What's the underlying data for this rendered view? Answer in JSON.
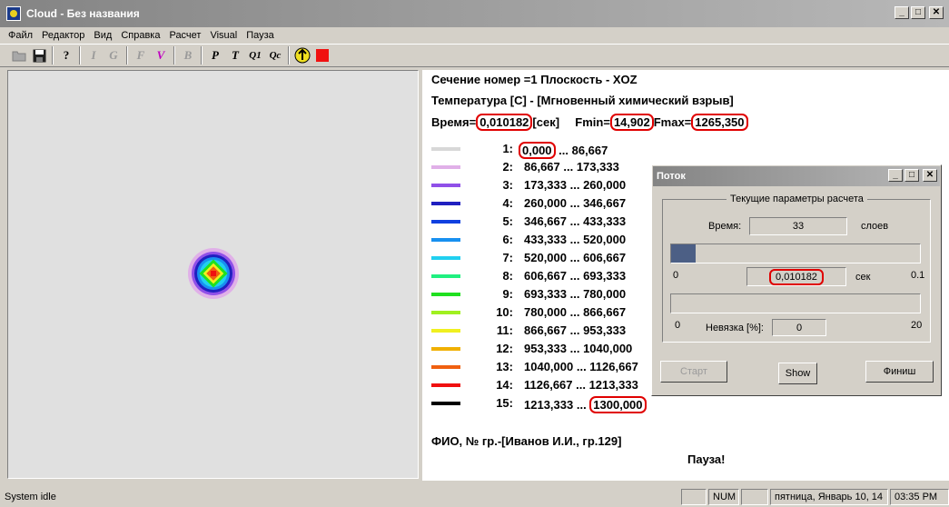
{
  "window": {
    "title": "Cloud - Без названия"
  },
  "menu": [
    "Файл",
    "Редактор",
    "Вид",
    "Справка",
    "Расчет",
    "Visual",
    "Пауза"
  ],
  "toolbar": [
    {
      "name": "open-folder-icon",
      "label": ""
    },
    {
      "name": "save-icon",
      "label": ""
    },
    {
      "name": "help-icon",
      "label": "?"
    },
    {
      "name": "tool-i-icon",
      "label": "I"
    },
    {
      "name": "tool-g-icon",
      "label": "G"
    },
    {
      "name": "tool-f-icon",
      "label": "F"
    },
    {
      "name": "tool-v-icon",
      "label": "V"
    },
    {
      "name": "tool-b-icon",
      "label": "B"
    },
    {
      "name": "tool-p-icon",
      "label": "P"
    },
    {
      "name": "tool-t-icon",
      "label": "T"
    },
    {
      "name": "tool-q1-icon",
      "label": "Q1"
    },
    {
      "name": "tool-qc-icon",
      "label": "Qc"
    },
    {
      "name": "start-calc-icon",
      "label": ""
    },
    {
      "name": "stop-icon",
      "label": ""
    }
  ],
  "info": {
    "section": "Сечение номер =1   Плоскость - XOZ",
    "temp_title": "Температура [C] - [Мгновенный химический взрыв]",
    "time_label": "Время=",
    "time_value": "0,010182",
    "time_unit": "[сек]",
    "fmin_label": "Fmin=",
    "fmin_value": "14,902",
    "fmax_label": "Fmax=",
    "fmax_value": "1265,350",
    "fio": "ФИО, № гр.-[Иванов И.И., гр.129]",
    "pause": "Пауза!"
  },
  "legend": [
    {
      "idx": "1:",
      "from": "0,000",
      "to": "86,667",
      "color": "#d8d8d8"
    },
    {
      "idx": "2:",
      "from": "86,667",
      "to": "173,333",
      "color": "#e0b0e8"
    },
    {
      "idx": "3:",
      "from": "173,333",
      "to": "260,000",
      "color": "#9050e8"
    },
    {
      "idx": "4:",
      "from": "260,000",
      "to": "346,667",
      "color": "#2020c0"
    },
    {
      "idx": "5:",
      "from": "346,667",
      "to": "433,333",
      "color": "#1040e0"
    },
    {
      "idx": "6:",
      "from": "433,333",
      "to": "520,000",
      "color": "#1890f0"
    },
    {
      "idx": "7:",
      "from": "520,000",
      "to": "606,667",
      "color": "#20d0f0"
    },
    {
      "idx": "8:",
      "from": "606,667",
      "to": "693,333",
      "color": "#20f080"
    },
    {
      "idx": "9:",
      "from": "693,333",
      "to": "780,000",
      "color": "#20e020"
    },
    {
      "idx": "10:",
      "from": "780,000",
      "to": "866,667",
      "color": "#a0f020"
    },
    {
      "idx": "11:",
      "from": "866,667",
      "to": "953,333",
      "color": "#f0f020"
    },
    {
      "idx": "12:",
      "from": "953,333",
      "to": "1040,000",
      "color": "#f0b000"
    },
    {
      "idx": "13:",
      "from": "1040,000",
      "to": "1126,667",
      "color": "#f06010"
    },
    {
      "idx": "14:",
      "from": "1126,667",
      "to": "1213,333",
      "color": "#f01010"
    },
    {
      "idx": "15:",
      "from": "1213,333",
      "to": "1300,000",
      "color": "#000000"
    }
  ],
  "dialog": {
    "title": "Поток",
    "group": "Текущие параметры расчета",
    "time_label": "Время:",
    "layers_value": "33",
    "layers_unit": "слоев",
    "progress_fraction": 0.1,
    "prog_min": "0",
    "time_value": "0,010182",
    "time_unit": "сек",
    "prog_max": "0.1",
    "nevyazka_min": "0",
    "nevyazka_label": "Невязка [%]:",
    "nevyazka_value": "0",
    "nevyazka_max": "20",
    "btn_start": "Старт",
    "btn_show": "Show",
    "btn_finish": "Финиш"
  },
  "status": {
    "text": "System idle",
    "num": "NUM",
    "date": "пятница, Январь 10, 14",
    "time": "03:35 PM"
  }
}
